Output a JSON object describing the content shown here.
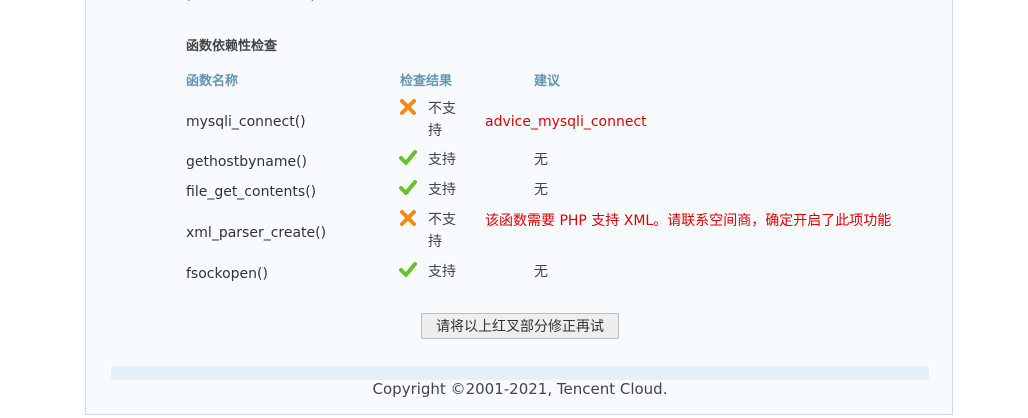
{
  "section_title": "函数依赖性检查",
  "columns": {
    "name": "函数名称",
    "result": "检查结果",
    "advice": "建议"
  },
  "rows": [
    {
      "name": "mysqli_connect()",
      "status": "不支持",
      "status_icon": "cross-icon",
      "advice": "advice_mysqli_connect"
    },
    {
      "name": "gethostbyname()",
      "status": "支持",
      "status_icon": "check-icon",
      "advice": "无"
    },
    {
      "name": "file_get_contents()",
      "status": "支持",
      "status_icon": "check-icon",
      "advice": "无"
    },
    {
      "name": "xml_parser_create()",
      "status": "不支持",
      "status_icon": "cross-icon",
      "advice": "该函数需要 PHP 支持 XML。请联系空间商，确定开启了此项功能"
    },
    {
      "name": "fsockopen()",
      "status": "支持",
      "status_icon": "check-icon",
      "advice": "无"
    }
  ],
  "retry_button": "请将以上红叉部分修正再试",
  "copyright": "Copyright ©2001-2021, Tencent Cloud.",
  "colors": {
    "panel_bg": "#f7fbfe",
    "panel_border": "#c9dde9",
    "header_text": "#6893b2",
    "warning_text": "#e00000",
    "check_green": "#6cc02a",
    "cross_orange": "#f58a14"
  }
}
